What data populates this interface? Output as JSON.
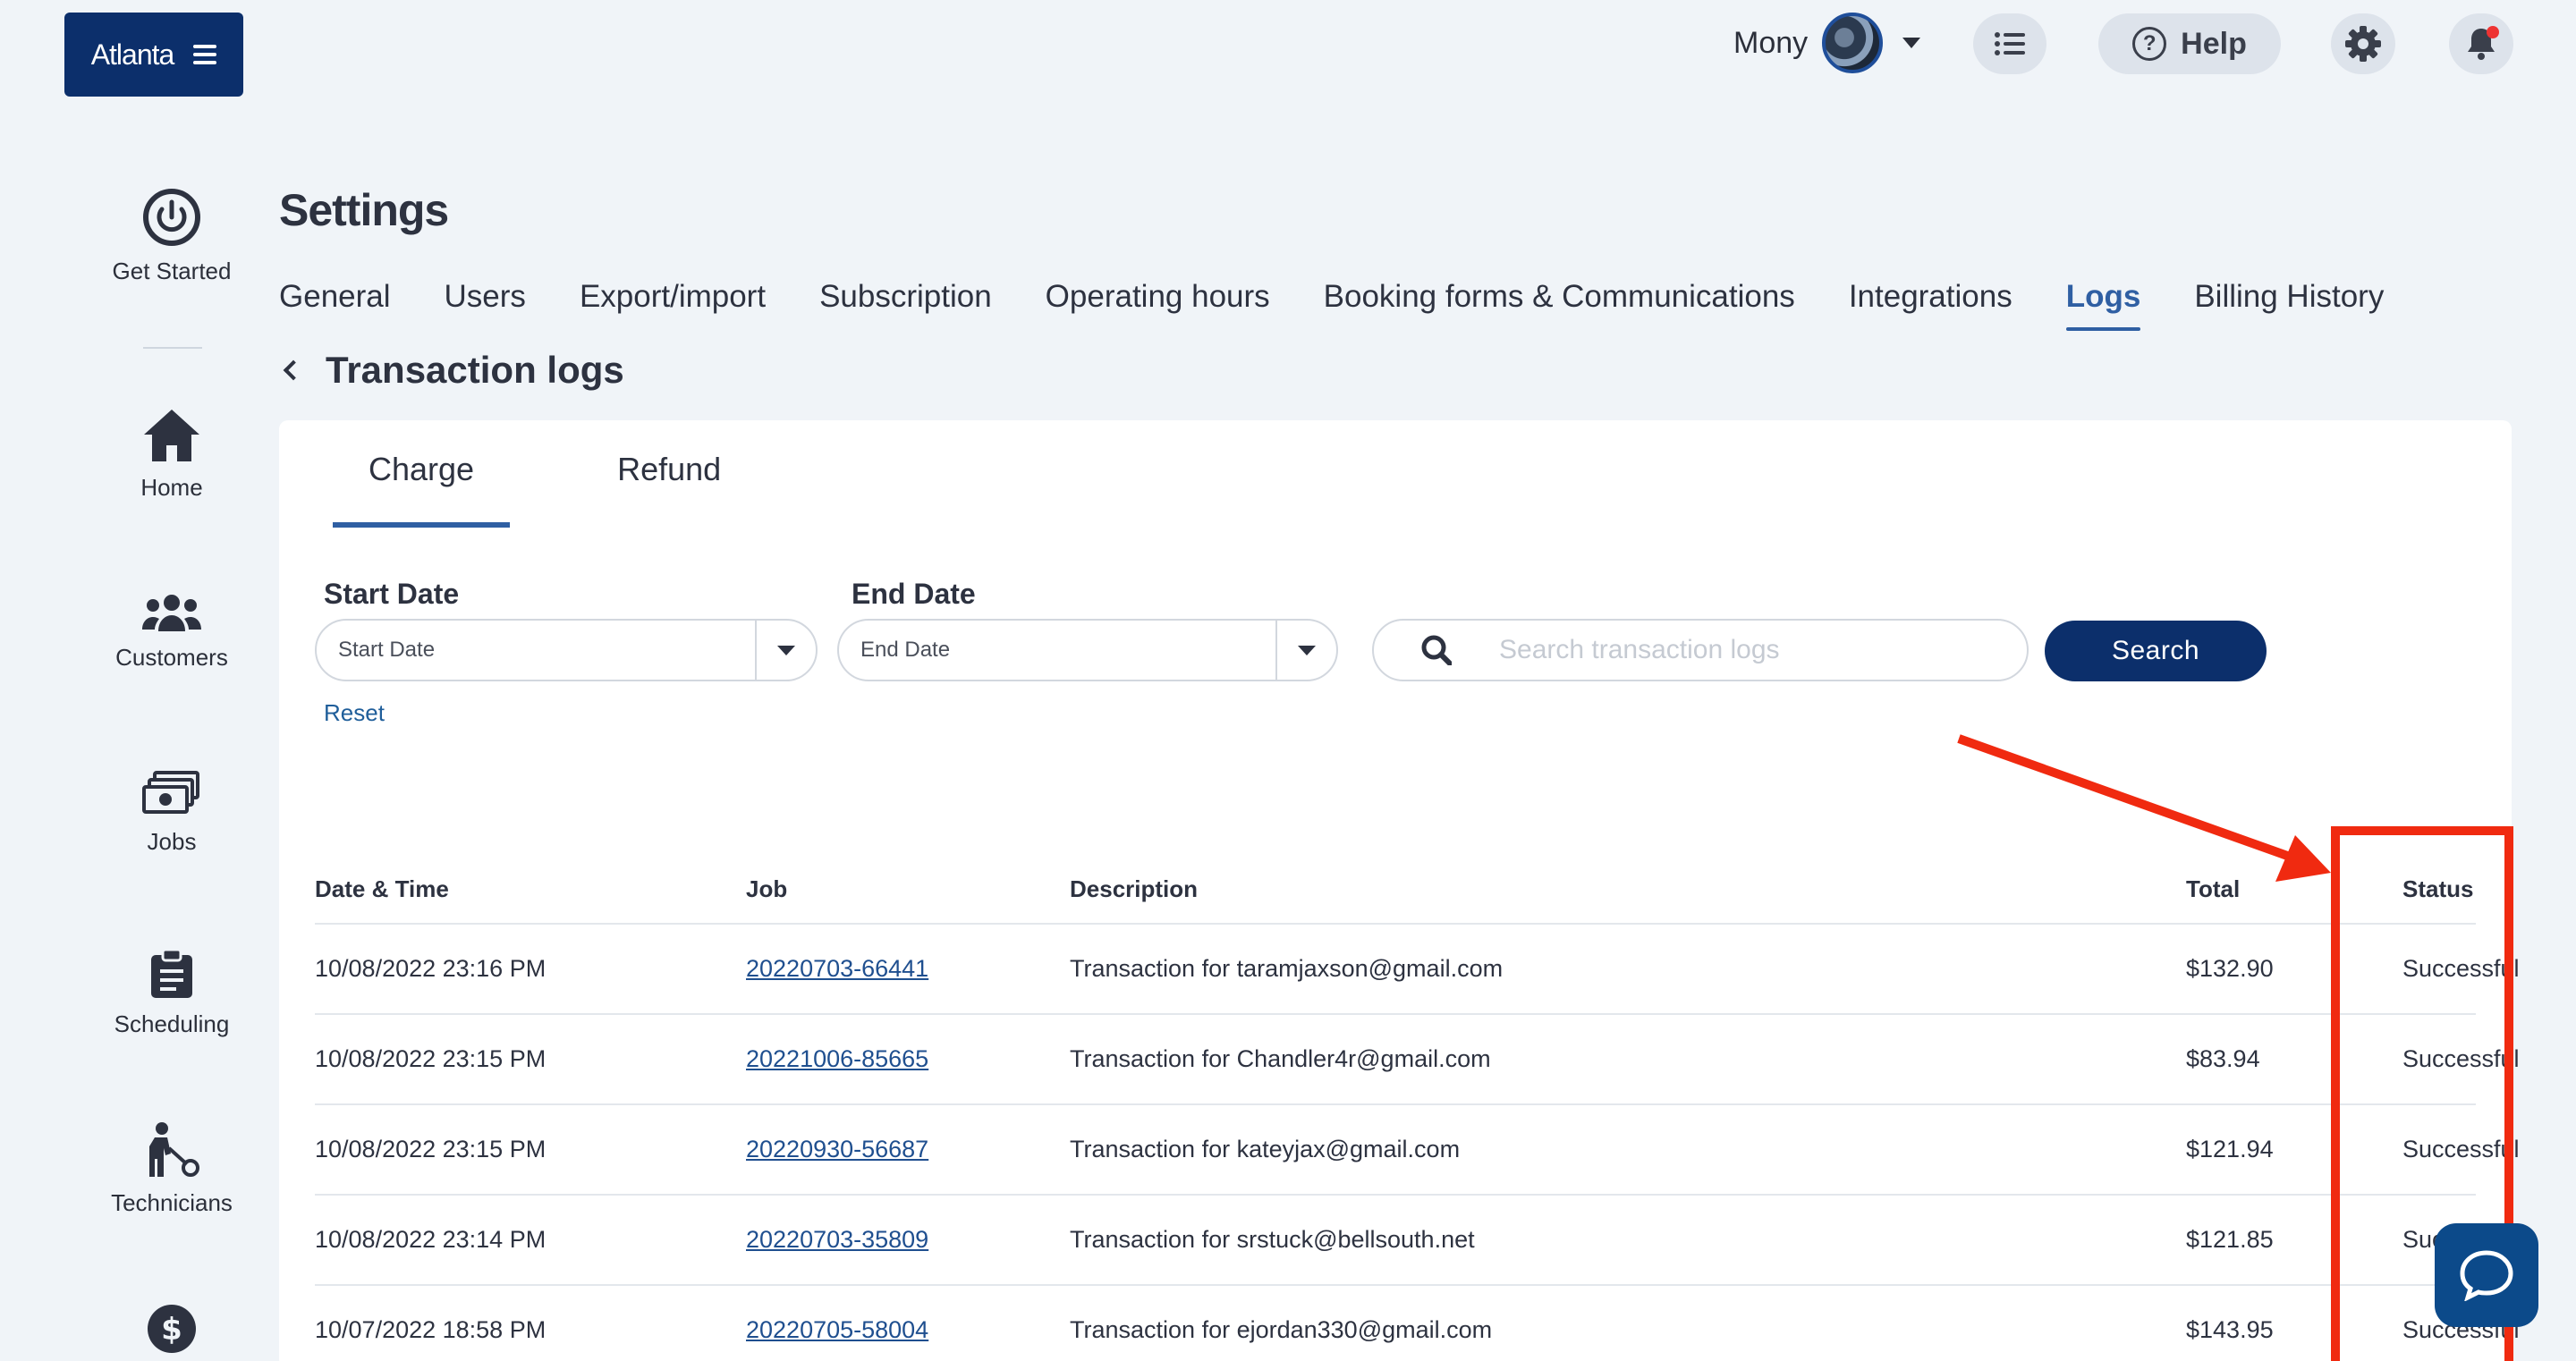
{
  "brand": {
    "label": "Atlanta"
  },
  "topbar": {
    "user_name": "Mony",
    "help_label": "Help"
  },
  "sidebar": {
    "items": [
      {
        "label": "Get Started",
        "icon": "power-icon"
      },
      {
        "label": "Home",
        "icon": "home-icon"
      },
      {
        "label": "Customers",
        "icon": "users-icon"
      },
      {
        "label": "Jobs",
        "icon": "money-stack-icon"
      },
      {
        "label": "Scheduling",
        "icon": "clipboard-icon"
      },
      {
        "label": "Technicians",
        "icon": "technician-icon"
      },
      {
        "label": "",
        "icon": "dollar-icon"
      }
    ]
  },
  "page": {
    "title": "Settings",
    "breadcrumb": "Transaction logs"
  },
  "tabs": [
    "General",
    "Users",
    "Export/import",
    "Subscription",
    "Operating hours",
    "Booking forms & Communications",
    "Integrations",
    "Logs",
    "Billing History"
  ],
  "active_tab": "Logs",
  "sub_tabs": [
    "Charge",
    "Refund"
  ],
  "filters": {
    "start_label": "Start Date",
    "start_placeholder": "Start Date",
    "end_label": "End Date",
    "end_placeholder": "End Date",
    "search_placeholder": "Search transaction logs",
    "search_button": "Search",
    "reset": "Reset"
  },
  "table": {
    "columns": [
      "Date & Time",
      "Job",
      "Description",
      "Total",
      "Status"
    ],
    "rows": [
      {
        "date": "10/08/2022 23:16 PM",
        "job": "20220703-66441",
        "desc": "Transaction for taramjaxson@gmail.com",
        "total": "$132.90",
        "status": "Successful"
      },
      {
        "date": "10/08/2022 23:15 PM",
        "job": "20221006-85665",
        "desc": "Transaction for Chandler4r@gmail.com",
        "total": "$83.94",
        "status": "Successful"
      },
      {
        "date": "10/08/2022 23:15 PM",
        "job": "20220930-56687",
        "desc": "Transaction for kateyjax@gmail.com",
        "total": "$121.94",
        "status": "Successful"
      },
      {
        "date": "10/08/2022 23:14 PM",
        "job": "20220703-35809",
        "desc": "Transaction for srstuck@bellsouth.net",
        "total": "$121.85",
        "status": "Successful"
      },
      {
        "date": "10/07/2022 18:58 PM",
        "job": "20220705-58004",
        "desc": "Transaction for ejordan330@gmail.com",
        "total": "$143.95",
        "status": "Successful"
      }
    ]
  },
  "colors": {
    "navy": "#0c2f6b",
    "accent": "#2f5fa3",
    "annotation": "#f02a10"
  }
}
